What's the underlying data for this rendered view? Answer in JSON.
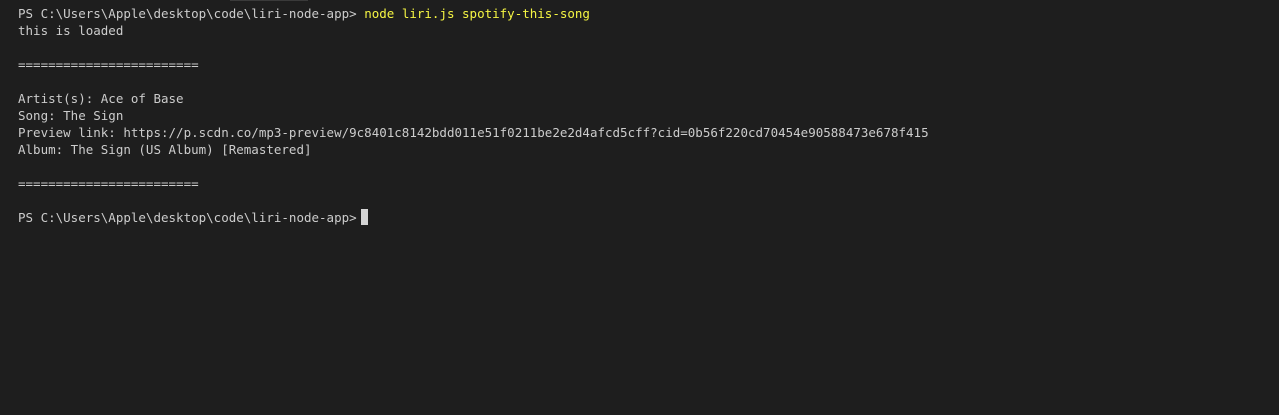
{
  "terminal": {
    "prompt_1": "PS C:\\Users\\Apple\\desktop\\code\\liri-node-app>",
    "command": "node liri.js spotify-this-song",
    "loaded_msg": "this is loaded",
    "separator_1": "========================",
    "artist_line": "Artist(s): Ace of Base",
    "song_line": "Song: The Sign",
    "preview_line": "Preview link: https://p.scdn.co/mp3-preview/9c8401c8142bdd011e51f0211be2e2d4afcd5cff?cid=0b56f220cd70454e90588473e678f415",
    "album_line": "Album: The Sign (US Album) [Remastered]",
    "separator_2": "========================",
    "prompt_2": "PS C:\\Users\\Apple\\desktop\\code\\liri-node-app>"
  },
  "colors": {
    "background": "#1e1e1e",
    "text": "#cccccc",
    "command": "#f5f543"
  }
}
